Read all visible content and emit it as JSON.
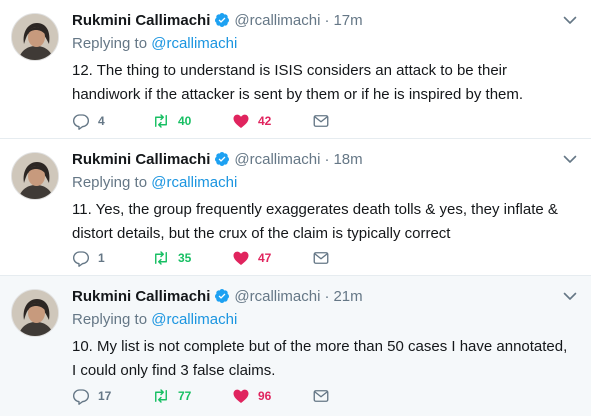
{
  "colors": {
    "name": "#14171a",
    "secondary": "#657786",
    "link": "#1b95e0",
    "verified": "#1da1f2",
    "retweeted": "#17bf63",
    "liked": "#e0245e",
    "highlight_bg": "#f5f8fa"
  },
  "tweets": [
    {
      "name": "Rukmini Callimachi",
      "handle": "@rcallimachi",
      "separator": "·",
      "time": "17m",
      "replying_prefix": "Replying to ",
      "replying_to": "@rcallimachi",
      "text": "12. The thing to understand is ISIS considers an attack to be their handiwork if the attacker is sent by them or if he is inspired by them.",
      "reply_count": "4",
      "retweet_count": "40",
      "like_count": "42",
      "icons": [
        "verified-badge-icon",
        "chevron-down-icon",
        "reply-icon",
        "retweet-icon",
        "heart-icon",
        "envelope-icon"
      ]
    },
    {
      "name": "Rukmini Callimachi",
      "handle": "@rcallimachi",
      "separator": "·",
      "time": "18m",
      "replying_prefix": "Replying to ",
      "replying_to": "@rcallimachi",
      "text": "11. Yes, the group frequently exaggerates death tolls & yes, they inflate & distort details, but the crux of the claim is typically correct",
      "reply_count": "1",
      "retweet_count": "35",
      "like_count": "47",
      "icons": [
        "verified-badge-icon",
        "chevron-down-icon",
        "reply-icon",
        "retweet-icon",
        "heart-icon",
        "envelope-icon"
      ]
    },
    {
      "name": "Rukmini Callimachi",
      "handle": "@rcallimachi",
      "separator": "·",
      "time": "21m",
      "replying_prefix": "Replying to ",
      "replying_to": "@rcallimachi",
      "text": "10. My list is not complete but of the more than 50 cases I have annotated, I could only find 3 false claims.",
      "reply_count": "17",
      "retweet_count": "77",
      "like_count": "96",
      "icons": [
        "verified-badge-icon",
        "chevron-down-icon",
        "reply-icon",
        "retweet-icon",
        "heart-icon",
        "envelope-icon"
      ]
    }
  ]
}
